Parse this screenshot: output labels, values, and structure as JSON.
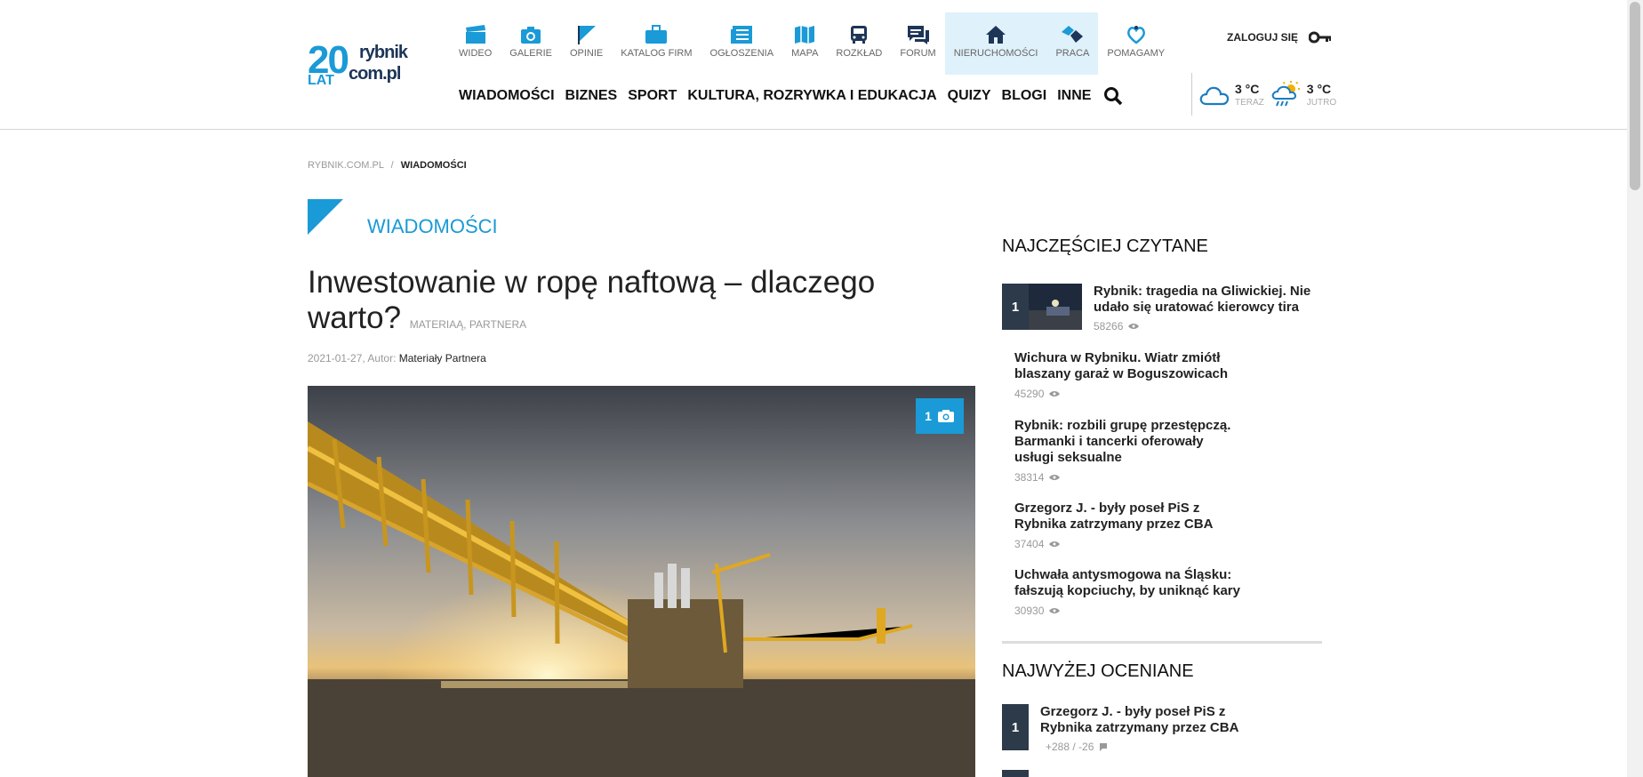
{
  "logo": {
    "big": "20",
    "lat": "LAT",
    "site1": "rybnik",
    "site2": "com.pl"
  },
  "icon_nav": [
    {
      "label": "WIDEO",
      "icon": "film-clapper-icon"
    },
    {
      "label": "GALERIE",
      "icon": "camera-icon"
    },
    {
      "label": "OPINIE",
      "icon": "flag-icon"
    },
    {
      "label": "KATALOG FIRM",
      "icon": "briefcase-icon"
    },
    {
      "label": "OGŁOSZENIA",
      "icon": "newspaper-icon"
    },
    {
      "label": "MAPA",
      "icon": "map-icon"
    },
    {
      "label": "ROZKŁAD",
      "icon": "bus-icon"
    },
    {
      "label": "FORUM",
      "icon": "chat-icon"
    },
    {
      "label": "NIERUCHOMOŚCI",
      "icon": "house-icon"
    },
    {
      "label": "PRACA",
      "icon": "handshake-icon"
    },
    {
      "label": "POMAGAMY",
      "icon": "heart-hand-icon"
    }
  ],
  "main_nav": [
    "WIADOMOŚCI",
    "BIZNES",
    "SPORT",
    "KULTURA, ROZRYWKA I EDUKACJA",
    "QUIZY",
    "BLOGI",
    "INNE"
  ],
  "login_label": "ZALOGUJ SIĘ",
  "weather": {
    "now": {
      "temp": "3 °C",
      "label": "TERAZ",
      "icon": "cloud-icon"
    },
    "tomorrow": {
      "temp": "3 °C",
      "label": "JUTRO",
      "icon": "sun-rain-icon"
    }
  },
  "breadcrumb": {
    "home": "RYBNIK.COM.PL",
    "sep": "/",
    "current": "WIADOMOŚCI"
  },
  "section_title": "WIADOMOŚCI",
  "article": {
    "title": "Inwestowanie w ropę naftową – dlaczego warto?",
    "tag": "MATERIAĄ, PARTNERA",
    "date": "2021-01-27, Autor:",
    "author": "Materiały Partnera",
    "photo_count": "1"
  },
  "most_read": {
    "heading": "NAJCZĘŚCIEJ CZYTANE",
    "items": [
      {
        "rank": "1",
        "title": "Rybnik: tragedia na Gliwickiej. Nie udało się uratować kierowcy tira",
        "views": "58266"
      },
      {
        "rank": "",
        "title": "Wichura w Rybniku. Wiatr zmiótł blaszany garaż w Boguszowicach",
        "views": "45290"
      },
      {
        "rank": "",
        "title": "Rybnik: rozbili grupę przestępczą. Barmanki i tancerki oferowały usługi seksualne",
        "views": "38314"
      },
      {
        "rank": "",
        "title": "Grzegorz J. - były poseł PiS z Rybnika zatrzymany przez CBA",
        "views": "37404"
      },
      {
        "rank": "",
        "title": "Uchwała antysmogowa na Śląsku: fałszują kopciuchy, by uniknąć kary",
        "views": "30930"
      }
    ]
  },
  "top_rated": {
    "heading": "NAJWYŻEJ OCENIANE",
    "items": [
      {
        "rank": "1",
        "title": "Grzegorz J. - były poseł PiS z Rybnika zatrzymany przez CBA",
        "score": "+288 / -26"
      }
    ]
  },
  "colors": {
    "accent": "#1a9ad6",
    "dark": "#2c3a4a",
    "highlight": "#dff1fa"
  }
}
